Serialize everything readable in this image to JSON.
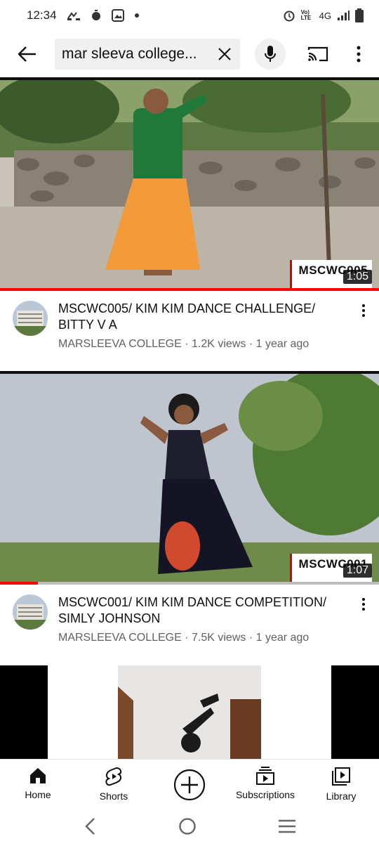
{
  "status_bar": {
    "time": "12:34",
    "network": "4G",
    "volte": "Vo) LTE"
  },
  "search": {
    "query": "mar sleeva college..."
  },
  "videos": [
    {
      "title": "MSCWC005/ KIM KIM DANCE CHALLENGE/ BITTY V A",
      "channel": "MARSLEEVA COLLEGE",
      "views": "1.2K views",
      "age": "1 year ago",
      "duration": "1:05",
      "watermark": "MSCWC005",
      "watched_fraction": 1.0
    },
    {
      "title": "MSCWC001/ KIM KIM DANCE COMPETITION/ SIMLY JOHNSON",
      "channel": "MARSLEEVA COLLEGE",
      "views": "7.5K views",
      "age": "1 year ago",
      "duration": "1:07",
      "watermark": "MSCWC001",
      "watched_fraction": 0.1
    }
  ],
  "separator_dot": " · ",
  "bottom_nav": {
    "home": "Home",
    "shorts": "Shorts",
    "subscriptions": "Subscriptions",
    "library": "Library"
  },
  "colors": {
    "accent": "#ff0000",
    "text_secondary": "#606060"
  }
}
